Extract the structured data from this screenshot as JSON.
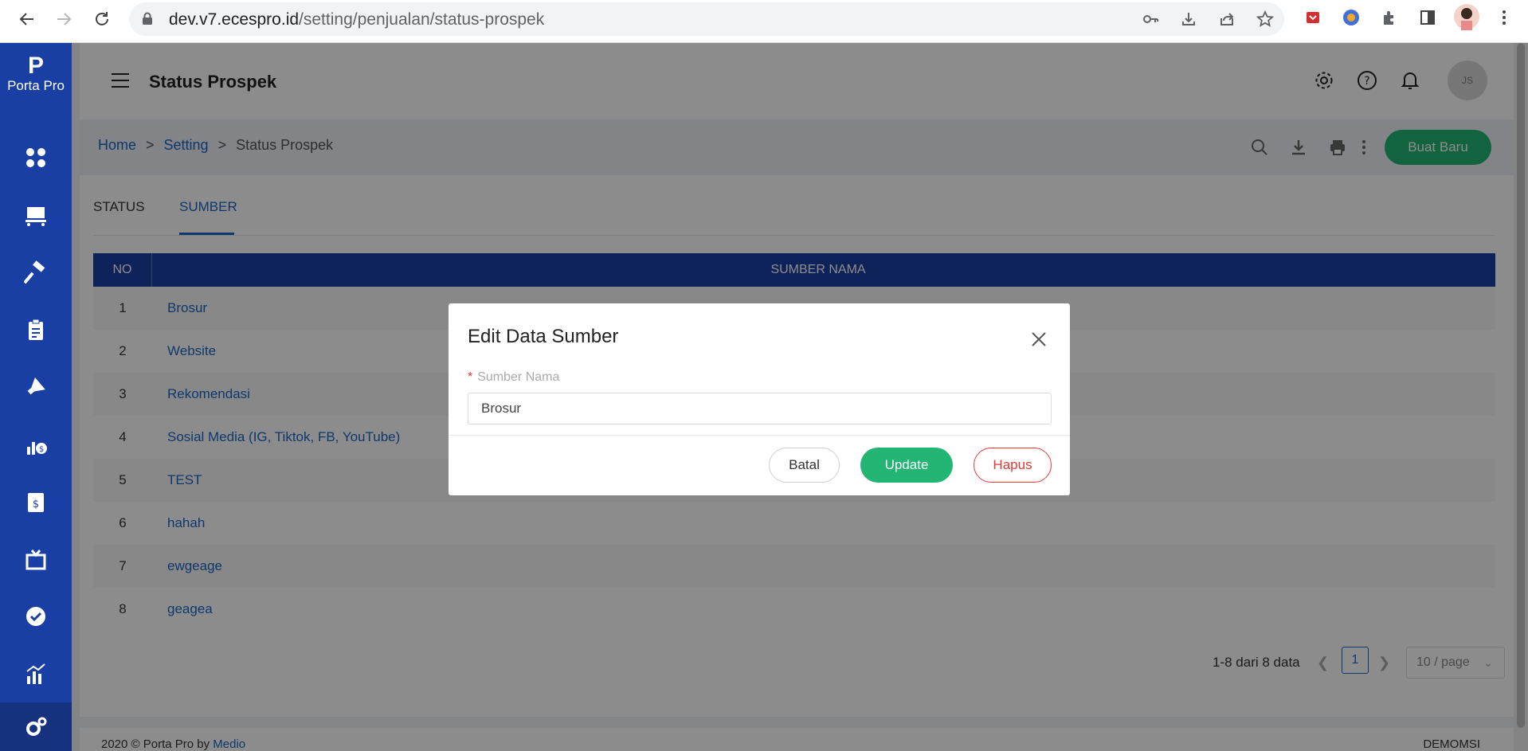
{
  "browser": {
    "url_host": "dev.v7.ecespro.id",
    "url_path": "/setting/penjualan/status-prospek"
  },
  "app": {
    "logo_text": "Porta Pro",
    "logo_mark": "P"
  },
  "header": {
    "title": "Status Prospek",
    "avatar_initials": "JS"
  },
  "breadcrumb": {
    "home": "Home",
    "setting": "Setting",
    "current": "Status Prospek",
    "separator": ">"
  },
  "toolbar": {
    "new_button": "Buat Baru"
  },
  "tabs": [
    {
      "label": "STATUS"
    },
    {
      "label": "SUMBER"
    }
  ],
  "table": {
    "col_no": "NO",
    "col_name": "SUMBER NAMA",
    "rows": [
      {
        "no": "1",
        "name": "Brosur"
      },
      {
        "no": "2",
        "name": "Website"
      },
      {
        "no": "3",
        "name": "Rekomendasi"
      },
      {
        "no": "4",
        "name": "Sosial Media (IG, Tiktok, FB, YouTube)"
      },
      {
        "no": "5",
        "name": "TEST"
      },
      {
        "no": "6",
        "name": "hahah"
      },
      {
        "no": "7",
        "name": "ewgeage"
      },
      {
        "no": "8",
        "name": "geagea"
      }
    ]
  },
  "pagination": {
    "info": "1-8 dari 8 data",
    "current_page": "1",
    "page_size": "10 / page"
  },
  "footer": {
    "copyright": "2020 © Porta Pro by ",
    "link": "Medio",
    "right": "DEMOMSI"
  },
  "modal": {
    "title": "Edit Data Sumber",
    "field_label": "Sumber Nama",
    "field_value": "Brosur",
    "cancel": "Batal",
    "update": "Update",
    "delete": "Hapus"
  },
  "colors": {
    "sidebar": "#1a3fa4",
    "accent": "#1a66c5",
    "success": "#22b573",
    "danger": "#e53935"
  }
}
